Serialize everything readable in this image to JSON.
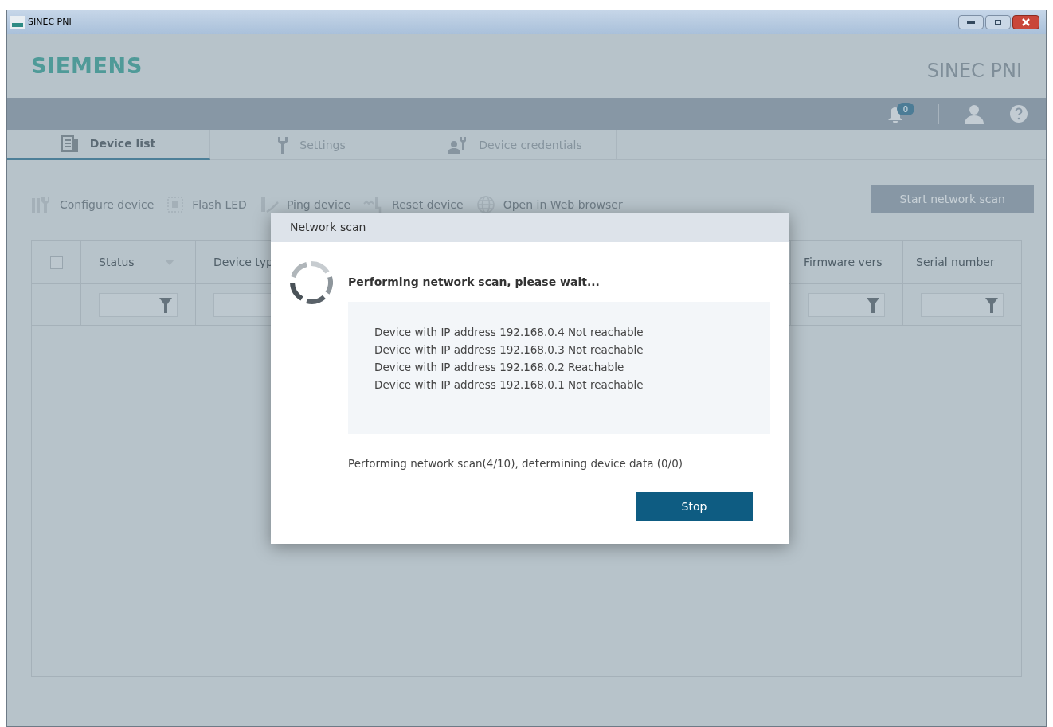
{
  "window": {
    "title": "SINEC PNI"
  },
  "header": {
    "brand": "SIEMENS",
    "product": "SINEC PNI",
    "notification_count": "0"
  },
  "tabs": [
    {
      "label": "Device list",
      "selected": true
    },
    {
      "label": "Settings",
      "selected": false
    },
    {
      "label": "Device credentials",
      "selected": false
    }
  ],
  "toolbar": {
    "actions": [
      {
        "label": "Configure device",
        "disabled": true
      },
      {
        "label": "Flash LED",
        "disabled": true
      },
      {
        "label": "Ping device",
        "disabled": true
      },
      {
        "label": "Reset device",
        "disabled": true
      },
      {
        "label": "Open in Web browser",
        "disabled": true
      }
    ],
    "scan_button": "Start network scan"
  },
  "table": {
    "select_all": {
      "checked": false
    },
    "columns": [
      {
        "label": "Status"
      },
      {
        "label": "Device typ"
      },
      {
        "label": "Firmware vers"
      },
      {
        "label": "Serial number"
      }
    ]
  },
  "dialog": {
    "title": "Network scan",
    "heading": "Performing network scan, please wait...",
    "log": [
      "Device with IP address 192.168.0.4 Not reachable",
      "Device with IP address 192.168.0.3 Not reachable",
      "Device with IP address 192.168.0.2 Reachable",
      "Device with IP address 192.168.0.1 Not reachable"
    ],
    "progress": "Performing network scan(4/10), determining device data (0/0)",
    "button": "Stop"
  }
}
